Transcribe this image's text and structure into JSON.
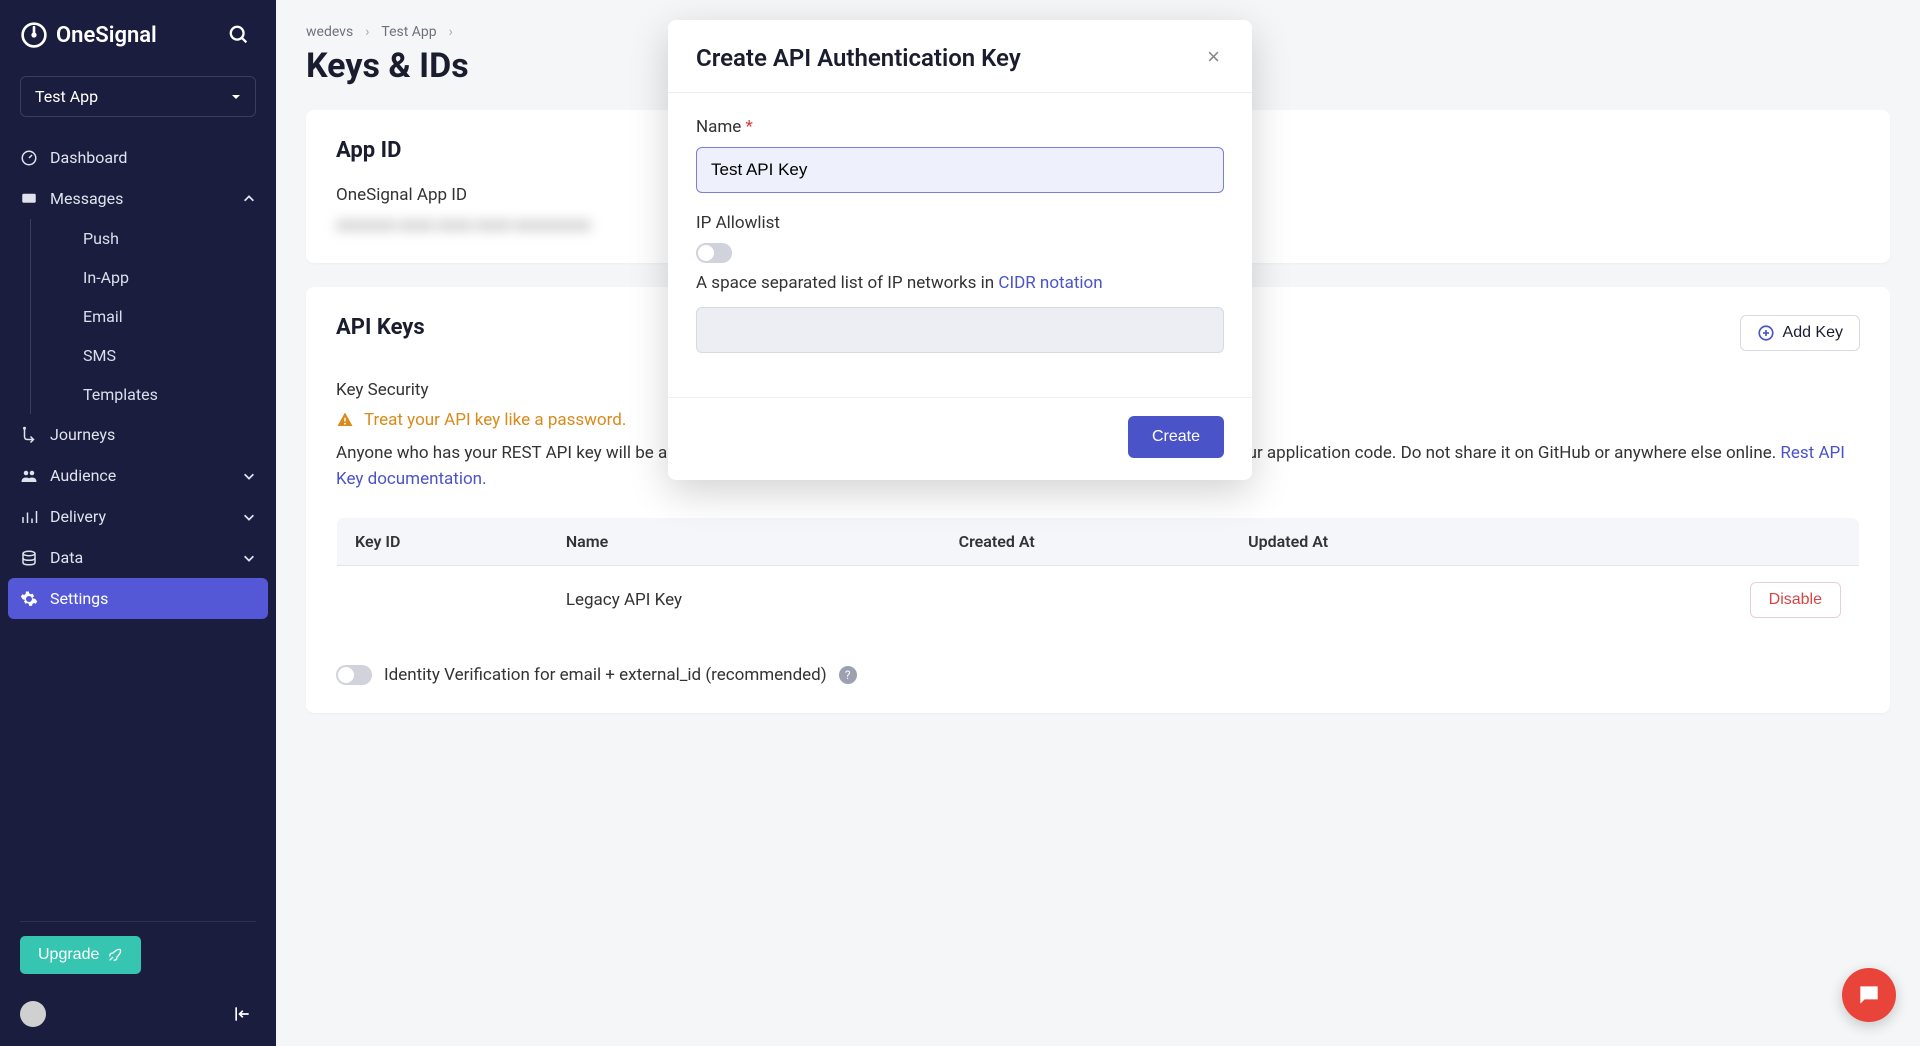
{
  "brand": {
    "name": "OneSignal"
  },
  "app_selector": {
    "current": "Test App"
  },
  "sidebar": {
    "items": {
      "dashboard": "Dashboard",
      "messages": "Messages",
      "journeys": "Journeys",
      "audience": "Audience",
      "delivery": "Delivery",
      "data": "Data",
      "settings": "Settings"
    },
    "messages_sub": {
      "push": "Push",
      "inapp": "In-App",
      "email": "Email",
      "sms": "SMS",
      "templates": "Templates"
    },
    "upgrade": "Upgrade"
  },
  "breadcrumb": {
    "org": "wedevs",
    "app": "Test App"
  },
  "page": {
    "title": "Keys & IDs"
  },
  "appid_card": {
    "title": "App ID",
    "label": "OneSignal App ID",
    "value_masked": "xxxxxxx-xxxx-xxxx-xxxx-xxxxxxxxx"
  },
  "apikeys_card": {
    "title": "API Keys",
    "add_button": "Add Key",
    "security_heading": "Key Security",
    "warning": "Treat your API key like a password.",
    "body": "Anyone who has your REST API key will be able to send notifications from your app. Do not expose the REST API key in your application code. Do not share it on GitHub or anywhere else online. ",
    "docs_link": "Rest API Key documentation.",
    "columns": {
      "key_id": "Key ID",
      "name": "Name",
      "created": "Created At",
      "updated": "Updated At"
    },
    "rows": [
      {
        "key_id": "",
        "name": "Legacy API Key",
        "created": "",
        "updated": ""
      }
    ],
    "disable": "Disable",
    "identity_toggle": "Identity Verification for email + external_id (recommended)"
  },
  "modal": {
    "title": "Create API Authentication Key",
    "name_label": "Name",
    "name_value": "Test API Key",
    "ip_label": "IP Allowlist",
    "ip_help_prefix": "A space separated list of IP networks in ",
    "ip_help_link": "CIDR notation",
    "create": "Create"
  }
}
